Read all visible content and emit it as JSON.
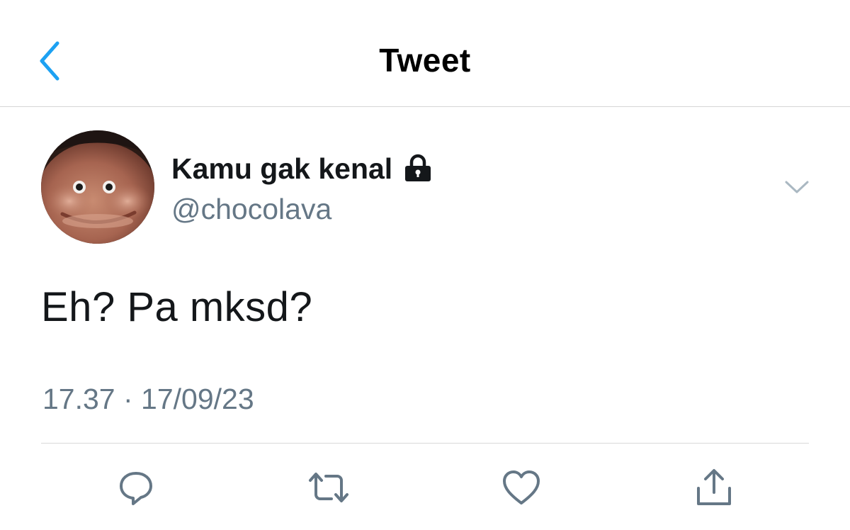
{
  "header": {
    "title": "Tweet",
    "back_icon": "chevron-left-icon",
    "accent_color": "#1da1f2"
  },
  "author": {
    "display_name": "Kamu gak kenal",
    "handle": "@chocolava",
    "protected_icon": "lock-icon",
    "avatar_icon": "avatar"
  },
  "tweet": {
    "text": "Eh? Pa mksd?",
    "timestamp": "17.37 · 17/09/23"
  },
  "actions": [
    {
      "name": "reply",
      "icon": "reply-icon"
    },
    {
      "name": "retweet",
      "icon": "retweet-icon"
    },
    {
      "name": "like",
      "icon": "heart-icon"
    },
    {
      "name": "share",
      "icon": "share-icon"
    }
  ],
  "colors": {
    "text_primary": "#14171a",
    "text_secondary": "#657786",
    "icon_gray": "#657786",
    "divider": "#d9d9d9"
  }
}
